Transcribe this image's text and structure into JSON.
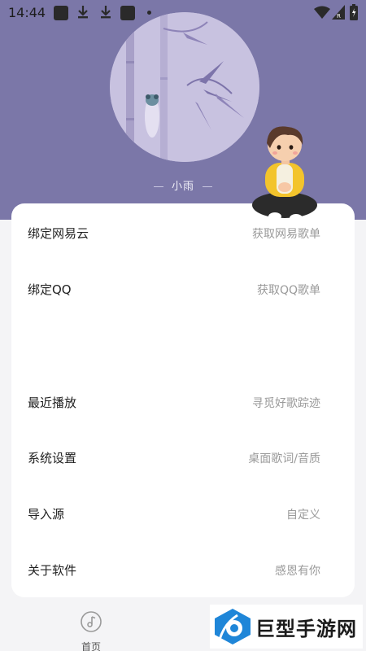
{
  "status_bar": {
    "time": "14:44",
    "icons": [
      "app-square-icon",
      "download-icon",
      "download-icon",
      "app-square-icon",
      "dot-icon",
      "wifi-icon",
      "signal-icon",
      "battery-icon"
    ]
  },
  "profile": {
    "username": "小雨",
    "avatar_icon": "bamboo-cicada-illustration",
    "theme_color": "#7b77a8"
  },
  "menu": {
    "items": [
      {
        "label": "绑定网易云",
        "hint": "获取网易歌单"
      },
      {
        "label": "绑定QQ",
        "hint": "获取QQ歌单"
      },
      {
        "label": "最近播放",
        "hint": "寻觅好歌踪迹"
      },
      {
        "label": "系统设置",
        "hint": "桌面歌词/音质"
      },
      {
        "label": "导入源",
        "hint": "自定义"
      },
      {
        "label": "关于软件",
        "hint": "感恩有你"
      }
    ]
  },
  "tab_bar": {
    "home_label": "首页",
    "home_icon": "music-disc-icon"
  },
  "watermark": {
    "text": "巨型手游网"
  }
}
